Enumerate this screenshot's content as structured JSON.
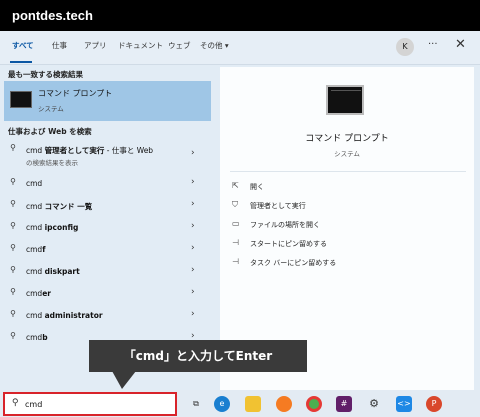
{
  "site_title": "pontdes.tech",
  "tabs": [
    "すべて",
    "仕事",
    "アプリ",
    "ドキュメント",
    "ウェブ",
    "その他 ▾"
  ],
  "avatar_letter": "K",
  "more_glyph": "···",
  "close_glyph": "✕",
  "best_match": {
    "heading": "最も一致する検索結果",
    "title": "コマンド プロンプト",
    "subtitle": "システム"
  },
  "web_section": {
    "heading": "仕事および Web を検索",
    "items": [
      {
        "pre": "cmd ",
        "bold": "管理者として実行",
        "post": " - 仕事と Web",
        "sub": "の検索結果を表示"
      },
      {
        "pre": "cmd",
        "bold": "",
        "post": "",
        "sub": ""
      },
      {
        "pre": "cmd ",
        "bold": "コマンド 一覧",
        "post": "",
        "sub": ""
      },
      {
        "pre": "cmd ",
        "bold": "ipconfig",
        "post": "",
        "sub": ""
      },
      {
        "pre": "cmd",
        "bold": "f",
        "post": "",
        "sub": ""
      },
      {
        "pre": "cmd ",
        "bold": "diskpart",
        "post": "",
        "sub": ""
      },
      {
        "pre": "cmd",
        "bold": "er",
        "post": "",
        "sub": ""
      },
      {
        "pre": "cmd ",
        "bold": "administrator",
        "post": "",
        "sub": ""
      },
      {
        "pre": "cmd",
        "bold": "b",
        "post": "",
        "sub": ""
      }
    ]
  },
  "preview": {
    "title": "コマンド プロンプト",
    "subtitle": "システム",
    "actions": [
      {
        "icon": "open-icon",
        "label": "開く"
      },
      {
        "icon": "shield-icon",
        "label": "管理者として実行"
      },
      {
        "icon": "folder-icon",
        "label": "ファイルの場所を開く"
      },
      {
        "icon": "pin-start-icon",
        "label": "スタートにピン留めする"
      },
      {
        "icon": "pin-taskbar-icon",
        "label": "タスク バーにピン留めする"
      }
    ]
  },
  "search": {
    "value": "cmd"
  },
  "callout": "「cmd」と入力してEnter",
  "taskbar": {
    "icons": [
      "task-view-icon",
      "edge-icon",
      "file-explorer-icon",
      "firefox-icon",
      "chrome-icon",
      "slack-icon",
      "settings-icon",
      "vscode-icon",
      "powerpoint-icon"
    ],
    "colors": {
      "accent": "#0b57a4",
      "highlight": "#9fc6e6",
      "callout": "#3a3a3a",
      "search_border": "#d8232a"
    }
  }
}
